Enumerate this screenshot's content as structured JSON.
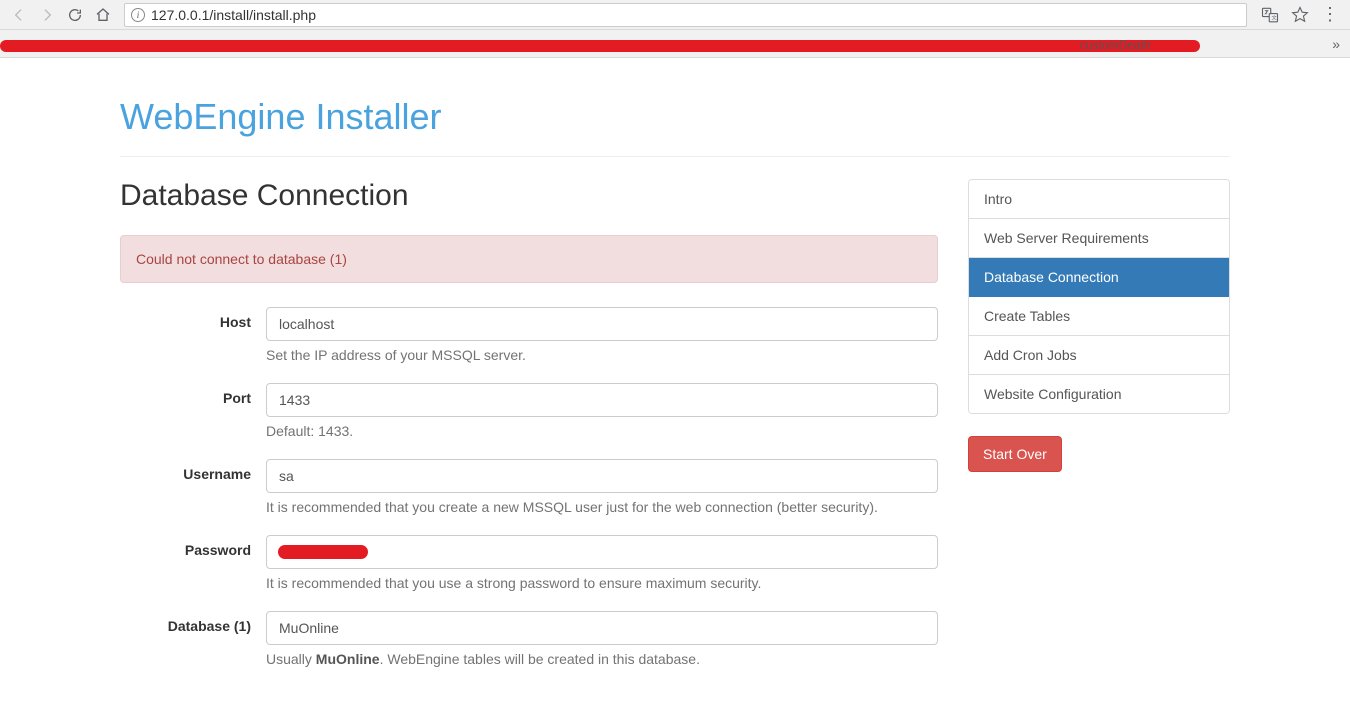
{
  "browser": {
    "url": "127.0.0.1/install/install.php",
    "bookmark_peek": "customDeath"
  },
  "page": {
    "title": "WebEngine Installer",
    "section_heading": "Database Connection"
  },
  "alert": {
    "message": "Could not connect to database (1)"
  },
  "form": {
    "host": {
      "label": "Host",
      "value": "localhost",
      "help": "Set the IP address of your MSSQL server."
    },
    "port": {
      "label": "Port",
      "value": "1433",
      "help": "Default: 1433."
    },
    "username": {
      "label": "Username",
      "value": "sa",
      "help": "It is recommended that you create a new MSSQL user just for the web connection (better security)."
    },
    "password": {
      "label": "Password",
      "value": "",
      "help": "It is recommended that you use a strong password to ensure maximum security."
    },
    "database1": {
      "label": "Database (1)",
      "value": "MuOnline",
      "help_prefix": "Usually ",
      "help_strong": "MuOnline",
      "help_suffix": ". WebEngine tables will be created in this database."
    }
  },
  "sidebar": {
    "items": [
      {
        "label": "Intro",
        "active": false
      },
      {
        "label": "Web Server Requirements",
        "active": false
      },
      {
        "label": "Database Connection",
        "active": true
      },
      {
        "label": "Create Tables",
        "active": false
      },
      {
        "label": "Add Cron Jobs",
        "active": false
      },
      {
        "label": "Website Configuration",
        "active": false
      }
    ],
    "start_over": "Start Over"
  }
}
